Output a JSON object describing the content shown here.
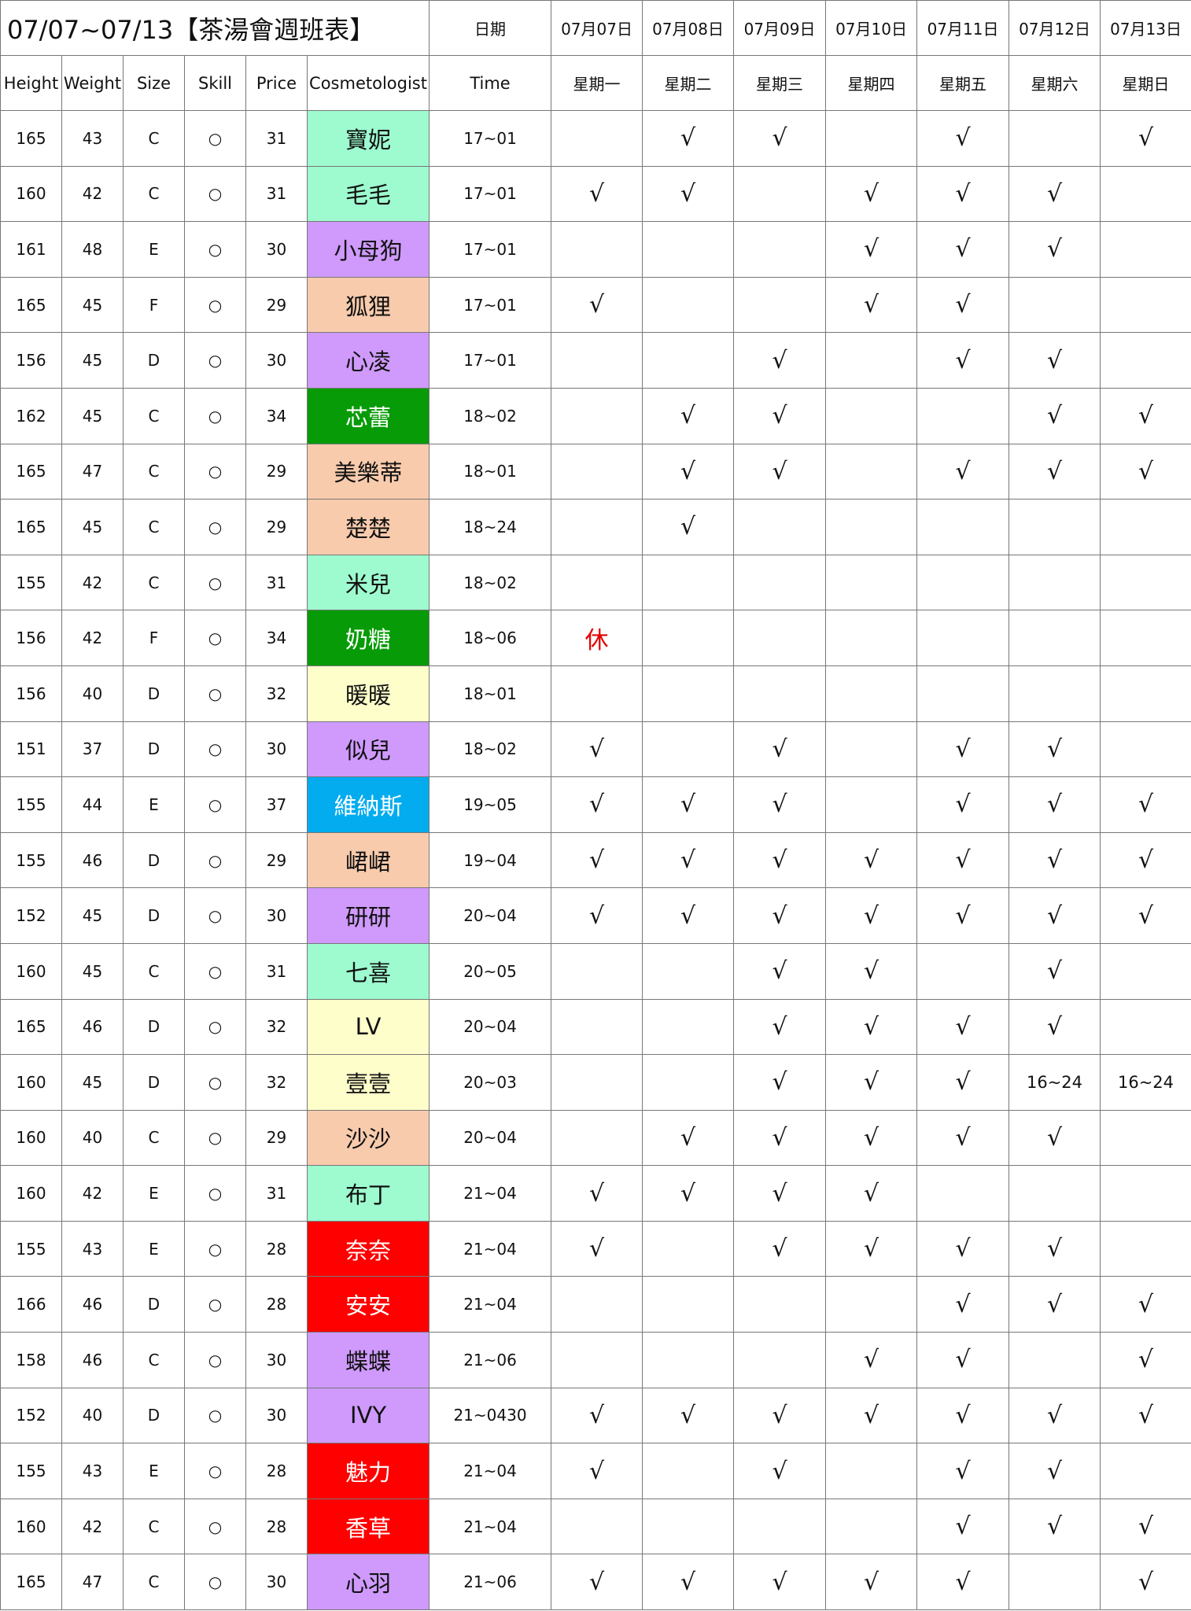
{
  "title": "07/07~07/13【茶湯會週班表】",
  "header": {
    "date_label": "日期",
    "time_label": "Time",
    "columns": [
      "Height",
      "Weight",
      "Size",
      "Skill",
      "Price",
      "Cosmetologist"
    ],
    "dates": [
      "07月07日",
      "07月08日",
      "07月09日",
      "07月10日",
      "07月11日",
      "07月12日",
      "07月13日"
    ],
    "weekdays": [
      "星期一",
      "星期二",
      "星期三",
      "星期四",
      "星期五",
      "星期六",
      "星期日"
    ]
  },
  "colors": {
    "mint": "#9dfbcf",
    "purple": "#cf9afc",
    "peach": "#f8cbad",
    "green": "#079b07",
    "cream": "#fefecb",
    "blue": "#02acef",
    "red": "#fe0000",
    "off_text": "#e10000"
  },
  "rows": [
    {
      "height": "165",
      "weight": "43",
      "size": "C",
      "skill": "○",
      "price": "31",
      "name": "寶妮",
      "color": "mint",
      "time": "17~01",
      "days": [
        "",
        "√",
        "√",
        "",
        "√",
        "",
        "√"
      ]
    },
    {
      "height": "160",
      "weight": "42",
      "size": "C",
      "skill": "○",
      "price": "31",
      "name": "毛毛",
      "color": "mint",
      "time": "17~01",
      "days": [
        "√",
        "√",
        "",
        "√",
        "√",
        "√",
        ""
      ]
    },
    {
      "height": "161",
      "weight": "48",
      "size": "E",
      "skill": "○",
      "price": "30",
      "name": "小母狗",
      "color": "purple",
      "time": "17~01",
      "days": [
        "",
        "",
        "",
        "√",
        "√",
        "√",
        ""
      ]
    },
    {
      "height": "165",
      "weight": "45",
      "size": "F",
      "skill": "○",
      "price": "29",
      "name": "狐狸",
      "color": "peach",
      "time": "17~01",
      "days": [
        "√",
        "",
        "",
        "√",
        "√",
        "",
        ""
      ]
    },
    {
      "height": "156",
      "weight": "45",
      "size": "D",
      "skill": "○",
      "price": "30",
      "name": "心凌",
      "color": "purple",
      "time": "17~01",
      "days": [
        "",
        "",
        "√",
        "",
        "√",
        "√",
        ""
      ]
    },
    {
      "height": "162",
      "weight": "45",
      "size": "C",
      "skill": "○",
      "price": "34",
      "name": "芯蕾",
      "color": "green",
      "time": "18~02",
      "days": [
        "",
        "√",
        "√",
        "",
        "",
        "√",
        "√"
      ]
    },
    {
      "height": "165",
      "weight": "47",
      "size": "C",
      "skill": "○",
      "price": "29",
      "name": "美樂蒂",
      "color": "peach",
      "time": "18~01",
      "days": [
        "",
        "√",
        "√",
        "",
        "√",
        "√",
        "√"
      ]
    },
    {
      "height": "165",
      "weight": "45",
      "size": "C",
      "skill": "○",
      "price": "29",
      "name": "楚楚",
      "color": "peach",
      "time": "18~24",
      "days": [
        "",
        "√",
        "",
        "",
        "",
        "",
        ""
      ]
    },
    {
      "height": "155",
      "weight": "42",
      "size": "C",
      "skill": "○",
      "price": "31",
      "name": "米兒",
      "color": "mint",
      "time": "18~02",
      "days": [
        "",
        "",
        "",
        "",
        "",
        "",
        ""
      ]
    },
    {
      "height": "156",
      "weight": "42",
      "size": "F",
      "skill": "○",
      "price": "34",
      "name": "奶糖",
      "color": "green",
      "time": "18~06",
      "days": [
        "休",
        "",
        "",
        "",
        "",
        "",
        ""
      ]
    },
    {
      "height": "156",
      "weight": "40",
      "size": "D",
      "skill": "○",
      "price": "32",
      "name": "暖暖",
      "color": "cream",
      "time": "18~01",
      "days": [
        "",
        "",
        "",
        "",
        "",
        "",
        ""
      ]
    },
    {
      "height": "151",
      "weight": "37",
      "size": "D",
      "skill": "○",
      "price": "30",
      "name": "似兒",
      "color": "purple",
      "time": "18~02",
      "days": [
        "√",
        "",
        "√",
        "",
        "√",
        "√",
        ""
      ]
    },
    {
      "height": "155",
      "weight": "44",
      "size": "E",
      "skill": "○",
      "price": "37",
      "name": "維納斯",
      "color": "blue",
      "time": "19~05",
      "days": [
        "√",
        "√",
        "√",
        "",
        "√",
        "√",
        "√"
      ]
    },
    {
      "height": "155",
      "weight": "46",
      "size": "D",
      "skill": "○",
      "price": "29",
      "name": "峮峮",
      "color": "peach",
      "time": "19~04",
      "days": [
        "√",
        "√",
        "√",
        "√",
        "√",
        "√",
        "√"
      ]
    },
    {
      "height": "152",
      "weight": "45",
      "size": "D",
      "skill": "○",
      "price": "30",
      "name": "研研",
      "color": "purple",
      "time": "20~04",
      "days": [
        "√",
        "√",
        "√",
        "√",
        "√",
        "√",
        "√"
      ]
    },
    {
      "height": "160",
      "weight": "45",
      "size": "C",
      "skill": "○",
      "price": "31",
      "name": "七喜",
      "color": "mint",
      "time": "20~05",
      "days": [
        "",
        "",
        "√",
        "√",
        "",
        "√",
        ""
      ]
    },
    {
      "height": "165",
      "weight": "46",
      "size": "D",
      "skill": "○",
      "price": "32",
      "name": "LV",
      "color": "cream",
      "time": "20~04",
      "days": [
        "",
        "",
        "√",
        "√",
        "√",
        "√",
        ""
      ]
    },
    {
      "height": "160",
      "weight": "45",
      "size": "D",
      "skill": "○",
      "price": "32",
      "name": "壹壹",
      "color": "cream",
      "time": "20~03",
      "days": [
        "",
        "",
        "√",
        "√",
        "√",
        "16~24",
        "16~24"
      ]
    },
    {
      "height": "160",
      "weight": "40",
      "size": "C",
      "skill": "○",
      "price": "29",
      "name": "沙沙",
      "color": "peach",
      "time": "20~04",
      "days": [
        "",
        "√",
        "√",
        "√",
        "√",
        "√",
        ""
      ]
    },
    {
      "height": "160",
      "weight": "42",
      "size": "E",
      "skill": "○",
      "price": "31",
      "name": "布丁",
      "color": "mint",
      "time": "21~04",
      "days": [
        "√",
        "√",
        "√",
        "√",
        "",
        "",
        ""
      ]
    },
    {
      "height": "155",
      "weight": "43",
      "size": "E",
      "skill": "○",
      "price": "28",
      "name": "奈奈",
      "color": "red",
      "time": "21~04",
      "days": [
        "√",
        "",
        "√",
        "√",
        "√",
        "√",
        ""
      ]
    },
    {
      "height": "166",
      "weight": "46",
      "size": "D",
      "skill": "○",
      "price": "28",
      "name": "安安",
      "color": "red",
      "time": "21~04",
      "days": [
        "",
        "",
        "",
        "",
        "√",
        "√",
        "√"
      ]
    },
    {
      "height": "158",
      "weight": "46",
      "size": "C",
      "skill": "○",
      "price": "30",
      "name": "蝶蝶",
      "color": "purple",
      "time": "21~06",
      "days": [
        "",
        "",
        "",
        "√",
        "√",
        "",
        "√"
      ]
    },
    {
      "height": "152",
      "weight": "40",
      "size": "D",
      "skill": "○",
      "price": "30",
      "name": "IVY",
      "color": "purple",
      "time": "21~0430",
      "days": [
        "√",
        "√",
        "√",
        "√",
        "√",
        "√",
        "√"
      ]
    },
    {
      "height": "155",
      "weight": "43",
      "size": "E",
      "skill": "○",
      "price": "28",
      "name": "魅力",
      "color": "red",
      "time": "21~04",
      "days": [
        "√",
        "",
        "√",
        "",
        "√",
        "√",
        ""
      ]
    },
    {
      "height": "160",
      "weight": "42",
      "size": "C",
      "skill": "○",
      "price": "28",
      "name": "香草",
      "color": "red",
      "time": "21~04",
      "days": [
        "",
        "",
        "",
        "",
        "√",
        "√",
        "√"
      ]
    },
    {
      "height": "165",
      "weight": "47",
      "size": "C",
      "skill": "○",
      "price": "30",
      "name": "心羽",
      "color": "purple",
      "time": "21~06",
      "days": [
        "√",
        "√",
        "√",
        "√",
        "√",
        "",
        "√"
      ]
    }
  ]
}
